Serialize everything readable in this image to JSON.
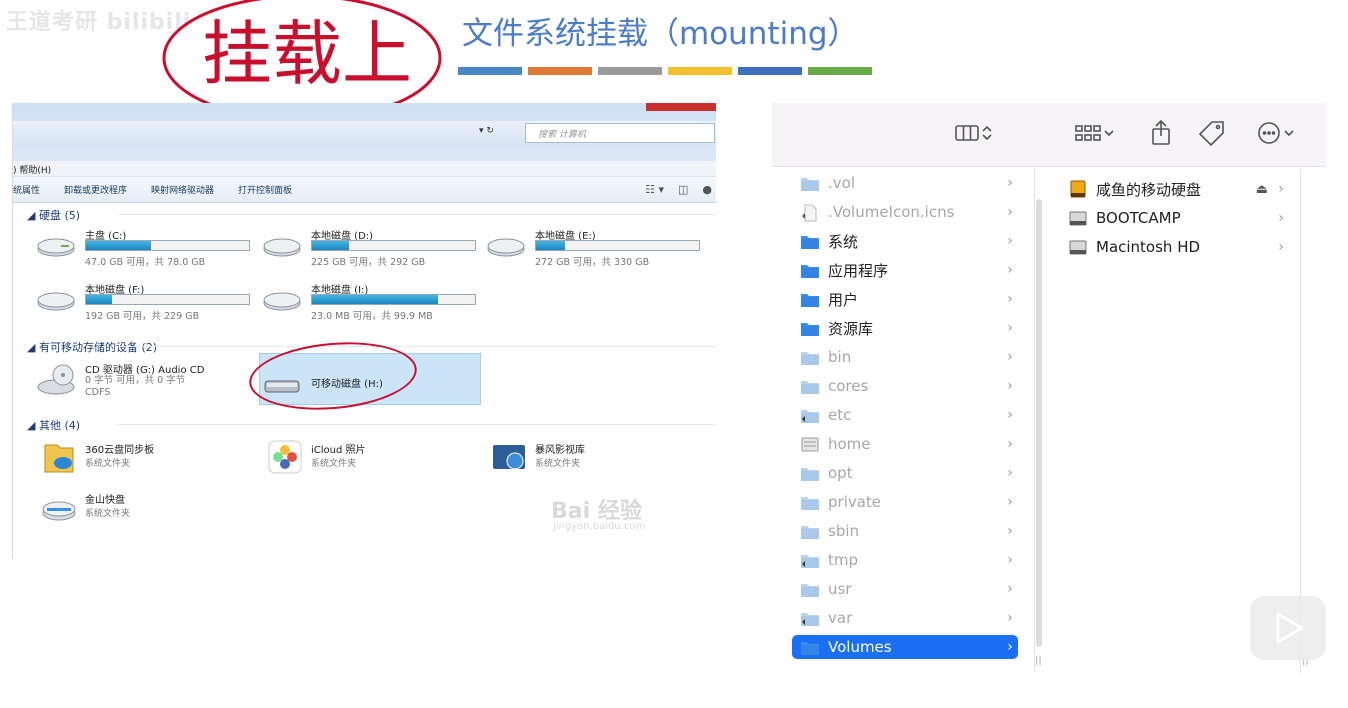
{
  "slide": {
    "title": "文件系统挂载（mounting）",
    "handwritten_note": "挂载上",
    "watermark": "王道考研 bilibili",
    "bar_colors": [
      "#4a86c5",
      "#e07b39",
      "#9a9a9a",
      "#f2c12e",
      "#3f6fbf",
      "#6aaa46"
    ]
  },
  "windows_explorer": {
    "search_placeholder": "搜索 计算机",
    "menu": {
      "help": ") 帮助(H)"
    },
    "toolbar": [
      "统属性",
      "卸载或更改程序",
      "映射网络驱动器",
      "打开控制面板"
    ],
    "groups": {
      "hard_disks": "◢ 硬盘 (5)",
      "removable": "◢ 有可移动存储的设备 (2)",
      "other": "◢ 其他 (4)"
    },
    "drives": [
      {
        "name": "主盘 (C:)",
        "info": "47.0 GB 可用，共 78.0 GB",
        "used_fraction": 0.4
      },
      {
        "name": "本地磁盘 (D:)",
        "info": "225 GB 可用，共 292 GB",
        "used_fraction": 0.23
      },
      {
        "name": "本地磁盘 (E:)",
        "info": "272 GB 可用，共 330 GB",
        "used_fraction": 0.18
      },
      {
        "name": "本地磁盘 (F:)",
        "info": "192 GB 可用，共 229 GB",
        "used_fraction": 0.16
      },
      {
        "name": "本地磁盘 (I:)",
        "info": "23.0 MB 可用，共 99.9 MB",
        "used_fraction": 0.77
      }
    ],
    "cd_drive": {
      "name": "CD 驱动器 (G:) Audio CD",
      "info": "0 字节 可用，共 0 字节",
      "fs": "CDFS"
    },
    "removable_drive": {
      "name": "可移动磁盘 (H:)"
    },
    "folders": [
      {
        "name": "360云盘同步板",
        "sub": "系统文件夹"
      },
      {
        "name": "iCloud 照片",
        "sub": "系统文件夹"
      },
      {
        "name": "暴风影视库",
        "sub": "系统文件夹"
      },
      {
        "name": "金山快盘",
        "sub": "系统文件夹"
      }
    ],
    "watermark": "Bai 经验",
    "watermark_url": "jingyan.baidu.com"
  },
  "finder": {
    "root_items": [
      {
        "label": ".vol",
        "dim": true,
        "icon": "folder-icon"
      },
      {
        "label": ".VolumeIcon.icns",
        "dim": true,
        "icon": "file-icon"
      },
      {
        "label": "系统",
        "dim": false,
        "icon": "folder-icon"
      },
      {
        "label": "应用程序",
        "dim": false,
        "icon": "folder-icon"
      },
      {
        "label": "用户",
        "dim": false,
        "icon": "folder-icon"
      },
      {
        "label": "资源库",
        "dim": false,
        "icon": "folder-icon"
      },
      {
        "label": "bin",
        "dim": true,
        "icon": "folder-icon"
      },
      {
        "label": "cores",
        "dim": true,
        "icon": "folder-icon"
      },
      {
        "label": "etc",
        "dim": true,
        "icon": "alias-folder-icon"
      },
      {
        "label": "home",
        "dim": true,
        "icon": "server-icon"
      },
      {
        "label": "opt",
        "dim": true,
        "icon": "folder-icon"
      },
      {
        "label": "private",
        "dim": true,
        "icon": "folder-icon"
      },
      {
        "label": "sbin",
        "dim": true,
        "icon": "folder-icon"
      },
      {
        "label": "tmp",
        "dim": true,
        "icon": "alias-folder-icon"
      },
      {
        "label": "usr",
        "dim": true,
        "icon": "folder-icon"
      },
      {
        "label": "var",
        "dim": true,
        "icon": "alias-folder-icon"
      },
      {
        "label": "Volumes",
        "dim": false,
        "icon": "folder-icon",
        "selected": true
      }
    ],
    "volumes": [
      {
        "label": "咸鱼的移动硬盘",
        "icon": "external-drive-icon",
        "eject": "⏏"
      },
      {
        "label": "BOOTCAMP",
        "icon": "internal-drive-icon"
      },
      {
        "label": "Macintosh HD",
        "icon": "internal-drive-icon"
      }
    ]
  }
}
